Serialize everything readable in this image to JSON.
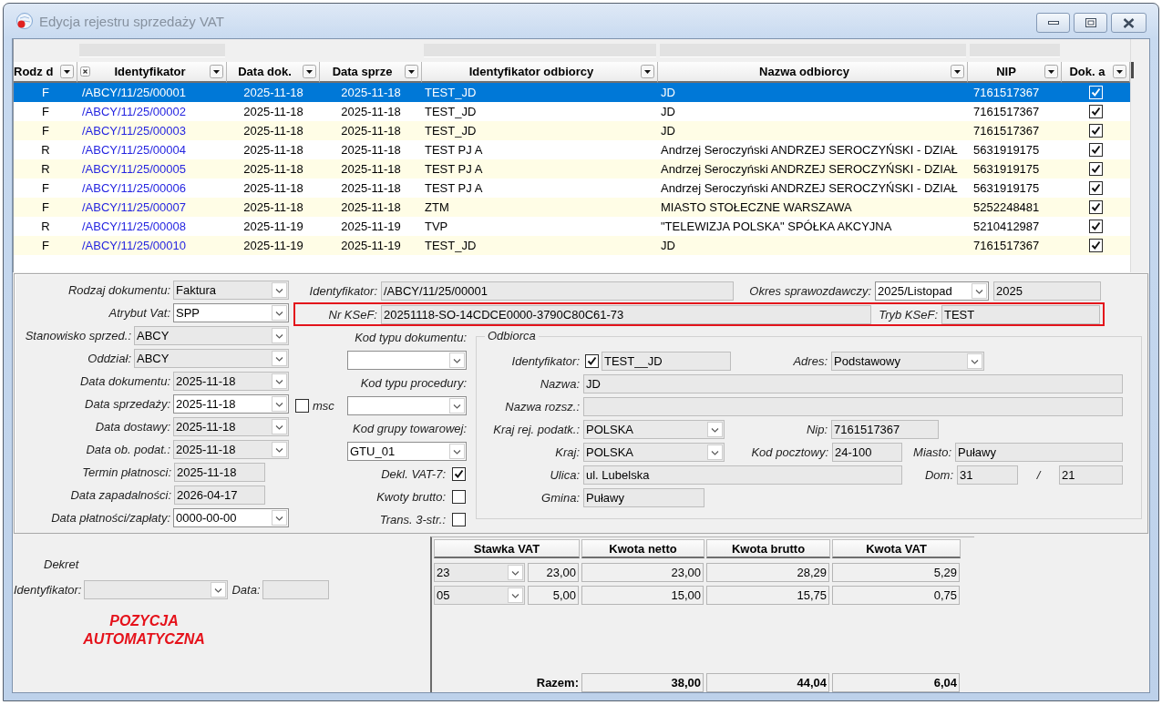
{
  "window": {
    "title": "Edycja rejestru sprzedaży VAT"
  },
  "register_table": {
    "columns": [
      {
        "label": "Rodz d",
        "filter": false,
        "clear": false
      },
      {
        "label": "Identyfikator",
        "filter": true,
        "clear": true
      },
      {
        "label": "Data dok.",
        "filter": false,
        "clear": false
      },
      {
        "label": "Data sprze",
        "filter": false,
        "clear": false
      },
      {
        "label": "Identyfikator odbiorcy",
        "filter": true,
        "clear": false
      },
      {
        "label": "Nazwa odbiorcy",
        "filter": true,
        "clear": false
      },
      {
        "label": "NIP",
        "filter": true,
        "clear": false
      },
      {
        "label": "Dok. a",
        "filter": false,
        "clear": false
      }
    ],
    "rows": [
      {
        "selected": true,
        "cells": [
          "F",
          "/ABCY/11/25/00001",
          "2025-11-18",
          "2025-11-18",
          "TEST_JD",
          "JD",
          "7161517367"
        ],
        "checked": true
      },
      {
        "selected": false,
        "cells": [
          "F",
          "/ABCY/11/25/00002",
          "2025-11-18",
          "2025-11-18",
          "TEST_JD",
          "JD",
          "7161517367"
        ],
        "checked": true
      },
      {
        "selected": false,
        "cells": [
          "F",
          "/ABCY/11/25/00003",
          "2025-11-18",
          "2025-11-18",
          "TEST_JD",
          "JD",
          "7161517367"
        ],
        "checked": true
      },
      {
        "selected": false,
        "cells": [
          "R",
          "/ABCY/11/25/00004",
          "2025-11-18",
          "2025-11-18",
          "TEST PJ A",
          "Andrzej Seroczyński ANDRZEJ SEROCZYŃSKI - DZIAŁ",
          "5631919175"
        ],
        "checked": true
      },
      {
        "selected": false,
        "cells": [
          "R",
          "/ABCY/11/25/00005",
          "2025-11-18",
          "2025-11-18",
          "TEST PJ A",
          "Andrzej Seroczyński ANDRZEJ SEROCZYŃSKI - DZIAŁ",
          "5631919175"
        ],
        "checked": true
      },
      {
        "selected": false,
        "cells": [
          "F",
          "/ABCY/11/25/00006",
          "2025-11-18",
          "2025-11-18",
          "TEST PJ A",
          "Andrzej Seroczyński ANDRZEJ SEROCZYŃSKI - DZIAŁ",
          "5631919175"
        ],
        "checked": true
      },
      {
        "selected": false,
        "cells": [
          "F",
          "/ABCY/11/25/00007",
          "2025-11-18",
          "2025-11-18",
          "ZTM",
          "MIASTO STOŁECZNE WARSZAWA",
          "5252248481"
        ],
        "checked": true
      },
      {
        "selected": false,
        "cells": [
          "R",
          "/ABCY/11/25/00008",
          "2025-11-19",
          "2025-11-19",
          "TVP",
          "\"TELEWIZJA POLSKA\" SPÓŁKA AKCYJNA",
          "5210412987"
        ],
        "checked": true
      },
      {
        "selected": false,
        "cells": [
          "F",
          "/ABCY/11/25/00010",
          "2025-11-19",
          "2025-11-19",
          "TEST_JD",
          "JD",
          "7161517367"
        ],
        "checked": true
      }
    ]
  },
  "document": {
    "fields": [
      {
        "label": "Rodzaj dokumentu:",
        "value": "Faktura",
        "kind": "combo",
        "readonly": true
      },
      {
        "label": "Atrybut Vat:",
        "value": "SPP",
        "kind": "combo",
        "readonly": false
      },
      {
        "label": "Stanowisko sprzed.:",
        "value": "ABCY",
        "kind": "combo",
        "readonly": true
      },
      {
        "label": "Oddział:",
        "value": "ABCY",
        "kind": "combo",
        "readonly": true
      },
      {
        "label": "Data dokumentu:",
        "value": "2025-11-18",
        "kind": "combo",
        "readonly": true
      },
      {
        "label": "Data sprzedaży:",
        "value": "2025-11-18",
        "kind": "combo",
        "readonly": false
      },
      {
        "label": "Data dostawy:",
        "value": "2025-11-18",
        "kind": "combo",
        "readonly": true
      },
      {
        "label": "Data ob. podat.:",
        "value": "2025-11-18",
        "kind": "combo",
        "readonly": true
      },
      {
        "label": "Termin płatnosci:",
        "value": "2025-11-18",
        "kind": "text",
        "readonly": true
      },
      {
        "label": "Data zapadalności:",
        "value": "2026-04-17",
        "kind": "text",
        "readonly": true
      },
      {
        "label": "Data płatności/zapłaty:",
        "value": "0000-00-00",
        "kind": "combo",
        "readonly": false
      }
    ],
    "msc": {
      "label": "msc",
      "checked": false
    },
    "header": [
      {
        "label": "Identyfikator:",
        "value": "/ABCY/11/25/00001",
        "kind": "text",
        "readonly": true
      },
      {
        "label": "Okres sprawozdawczy:",
        "value": "2025/Listopad",
        "kind": "combo",
        "readonly": false
      },
      {
        "value": "2025",
        "kind": "text",
        "readonly": true
      }
    ],
    "ksef": {
      "highlighted": true,
      "fields": [
        {
          "label": "Nr KSeF:",
          "value": "20251118-SO-14CDCE0000-3790C80C61-73",
          "readonly": true
        },
        {
          "label": "Tryb KSeF:",
          "value": "TEST",
          "readonly": true
        }
      ]
    },
    "codes": [
      {
        "label": "Kod typu dokumentu:",
        "readonly": false
      },
      {
        "label": "Kod typu procedury:",
        "readonly": false
      },
      {
        "label": "Kod grupy towarowej:",
        "value": "GTU_01",
        "readonly": false
      }
    ],
    "flags": [
      {
        "label": "Dekl. VAT-7:",
        "checked": true
      },
      {
        "label": "Kwoty brutto:",
        "checked": false
      },
      {
        "label": "Trans. 3-str.:",
        "checked": false
      }
    ]
  },
  "buyer": {
    "title": "Odbiorca",
    "rows": [
      {
        "items": [
          {
            "kind": "check",
            "label": "Identyfikator:",
            "checked": true
          },
          {
            "kind": "text",
            "value": "TEST__JD",
            "readonly": true
          },
          {
            "kind": "combo",
            "label": "Adres:",
            "value": "Podstawowy",
            "readonly": true
          }
        ]
      },
      {
        "items": [
          {
            "kind": "text",
            "label": "Nazwa:",
            "value": "JD",
            "readonly": true
          }
        ]
      },
      {
        "items": [
          {
            "kind": "text",
            "label": "Nazwa rozsz.:",
            "readonly": true
          }
        ]
      },
      {
        "items": [
          {
            "kind": "combo",
            "label": "Kraj rej. podatk.:",
            "value": "POLSKA",
            "readonly": true
          },
          {
            "kind": "text",
            "label": "Nip:",
            "value": "7161517367",
            "readonly": true
          }
        ]
      },
      {
        "items": [
          {
            "kind": "combo",
            "label": "Kraj:",
            "value": "POLSKA",
            "readonly": true
          },
          {
            "kind": "text",
            "label": "Kod pocztowy:",
            "value": "24-100",
            "readonly": true
          },
          {
            "kind": "text",
            "label": "Miasto:",
            "value": "Puławy",
            "readonly": true
          }
        ]
      },
      {
        "items": [
          {
            "kind": "text",
            "label": "Ulica:",
            "value": "ul. Lubelska",
            "readonly": true
          },
          {
            "kind": "text",
            "label": "Dom:",
            "value": "31",
            "readonly": true
          },
          {
            "kind": "text",
            "label": "/",
            "value": "21",
            "readonly": true
          }
        ]
      },
      {
        "items": [
          {
            "kind": "text",
            "label": "Gmina:",
            "value": "Puławy",
            "readonly": true
          }
        ]
      }
    ]
  },
  "decree": {
    "title": "Dekret",
    "fields": [
      {
        "label": "Identyfikator:",
        "kind": "combo",
        "readonly": true
      },
      {
        "label": "Data:",
        "kind": "text",
        "readonly": true
      }
    ],
    "notice": "POZYCJA AUTOMATYCZNA"
  },
  "vat_table": {
    "columns": [
      "Stawka VAT",
      "Kwota netto",
      "Kwota brutto",
      "Kwota VAT"
    ],
    "rows": [
      {
        "rate_code": "23",
        "rate": "23,00",
        "net": "23,00",
        "gross": "28,29",
        "vat": "5,29"
      },
      {
        "rate_code": "05",
        "rate": "5,00",
        "net": "15,00",
        "gross": "15,75",
        "vat": "0,75"
      }
    ],
    "total": {
      "label": "Razem:",
      "net": "38,00",
      "gross": "44,04",
      "vat": "6,04"
    }
  }
}
